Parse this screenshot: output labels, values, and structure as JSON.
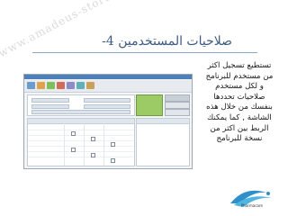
{
  "slide": {
    "title": "صلاحيات المستخدمين",
    "title_number": "4-",
    "body_lines": [
      "تستطيع تسجيل اكثر",
      "من مستخدم للبرنامج",
      "و لكل مستخدم",
      "صلاحيات تحددها",
      "بنفسك من خلال هذه",
      "الشاشة , كما يمكنك",
      "الربط بين اكثر من",
      "نسخة للبرنامج"
    ],
    "watermark": "www.amadeus-store.com",
    "logo_text": "Pharmacare",
    "colors": {
      "title": "#3d5a80",
      "accent_green": "#9ccb66",
      "titlebar": "#4d7fb8"
    }
  }
}
